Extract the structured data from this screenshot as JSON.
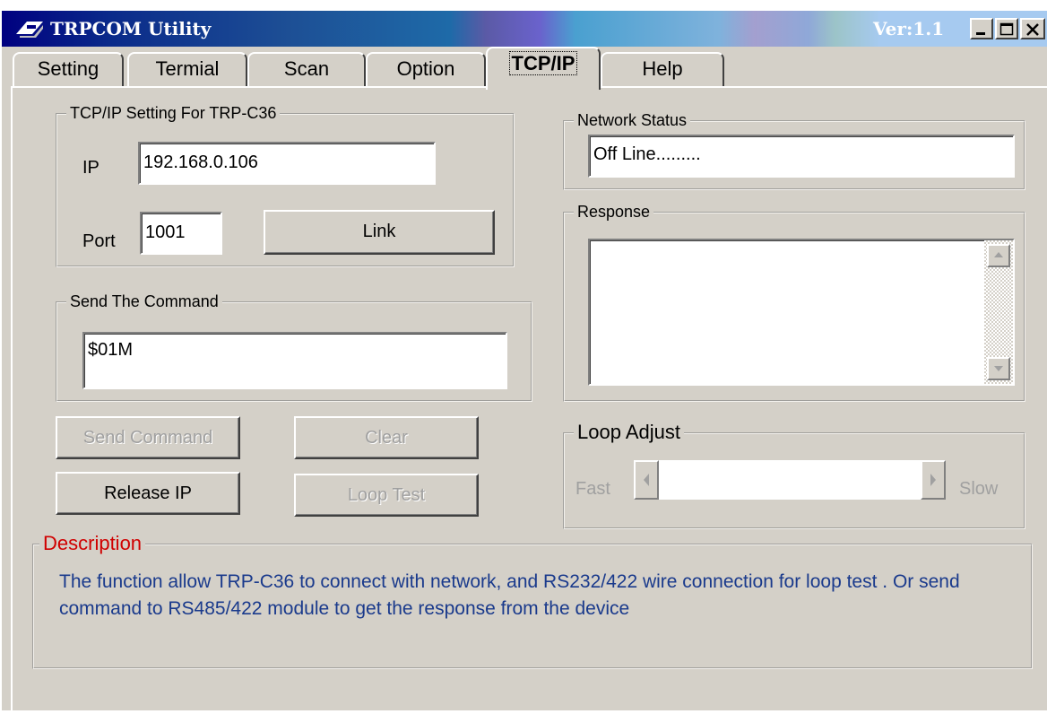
{
  "window": {
    "title": "TRPCOM Utility",
    "version": "Ver:1.1"
  },
  "tabs": [
    "Setting",
    "Termial",
    "Scan",
    "Option",
    "TCP/IP",
    "Help"
  ],
  "active_tab": "TCP/IP",
  "tcpip_setting": {
    "legend": "TCP/IP Setting For TRP-C36",
    "ip_label": "IP",
    "ip_value": "192.168.0.106",
    "port_label": "Port",
    "port_value": "1001",
    "link_button": "Link"
  },
  "send_command": {
    "legend": "Send The Command",
    "value": "$01M"
  },
  "buttons": {
    "send_command": "Send Command",
    "clear": "Clear",
    "release_ip": "Release IP",
    "loop_test": "Loop Test"
  },
  "network_status": {
    "legend": "Network Status",
    "value": "Off Line........."
  },
  "response": {
    "legend": "Response",
    "value": ""
  },
  "loop_adjust": {
    "legend": "Loop Adjust",
    "fast_label": "Fast",
    "slow_label": "Slow"
  },
  "description": {
    "legend": "Description",
    "text": "The function allow TRP-C36 to connect with network, and RS232/422 wire connection for loop test . Or send command to RS485/422  module  to get the response from the device"
  },
  "colors": {
    "description_legend": "#d00000",
    "description_text": "#1a3a8c"
  }
}
